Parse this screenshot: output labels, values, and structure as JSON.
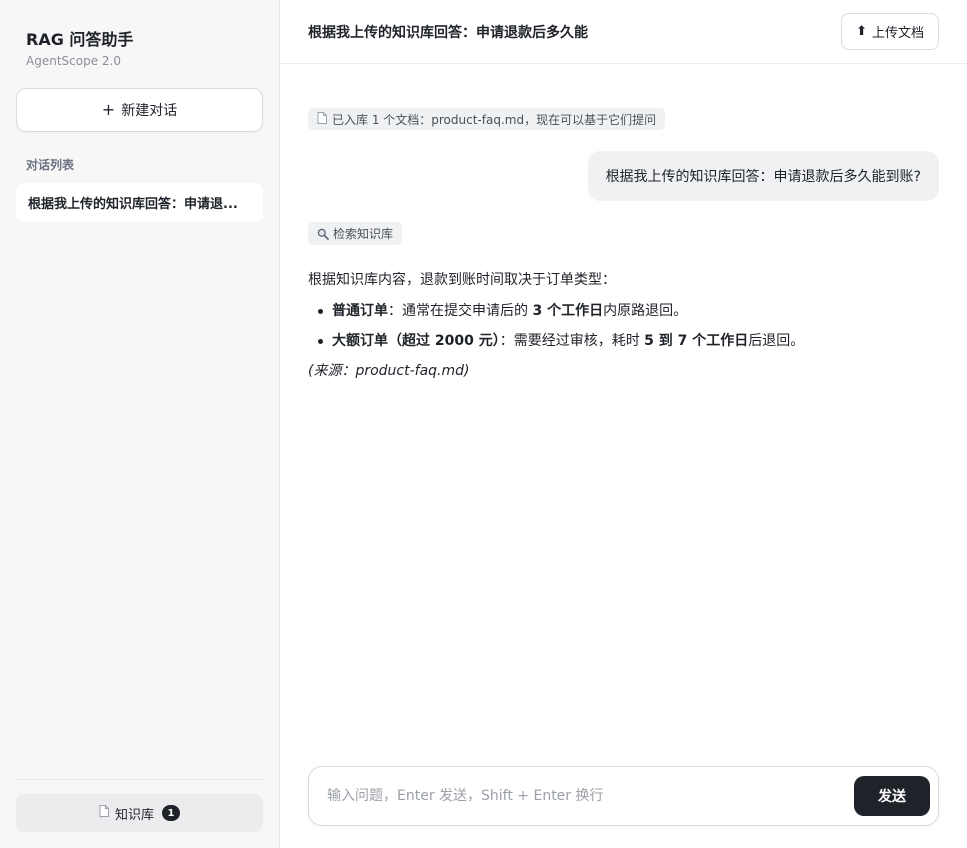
{
  "sidebar": {
    "brand_title": "RAG 问答助手",
    "brand_subtitle": "AgentScope 2.0",
    "new_chat_plus": "+",
    "new_chat_label": "新建对话",
    "section_label": "对话列表",
    "conversations": [
      {
        "title": "根据我上传的知识库回答：申请退..."
      }
    ],
    "kb_label": "知识库",
    "kb_count": "1"
  },
  "header": {
    "title": "根据我上传的知识库回答：申请退款后多久能",
    "upload_arrow": "⬆",
    "upload_label": "上传文档"
  },
  "chat": {
    "notice": "已入库 1 个文档：product-faq.md，现在可以基于它们提问",
    "user_message": "根据我上传的知识库回答：申请退款后多久能到账?",
    "tool_tag": "检索知识库",
    "answer_intro": "根据知识库内容，退款到账时间取决于订单类型：",
    "bullets": [
      {
        "label": "普通订单",
        "sep": "：",
        "pre": "通常在提交申请后的 ",
        "emph": "3 个工作日",
        "post": "内原路退回。"
      },
      {
        "label": "大额订单（超过 2000 元）",
        "sep": "：",
        "pre": "需要经过审核，耗时 ",
        "emph": "5 到 7 个工作日",
        "post": "后退回。"
      }
    ],
    "source": "(来源：product-faq.md)"
  },
  "composer": {
    "placeholder": "输入问题，Enter 发送，Shift + Enter 换行",
    "send_label": "发送"
  },
  "colors": {
    "accent_dark": "#1f2329",
    "sidebar_bg": "#f7f7f8",
    "bubble_bg": "#f0f1f3"
  },
  "icons": {
    "document": "document-icon",
    "search": "search-icon",
    "upload": "upload-arrow-icon",
    "plus": "plus-icon"
  }
}
